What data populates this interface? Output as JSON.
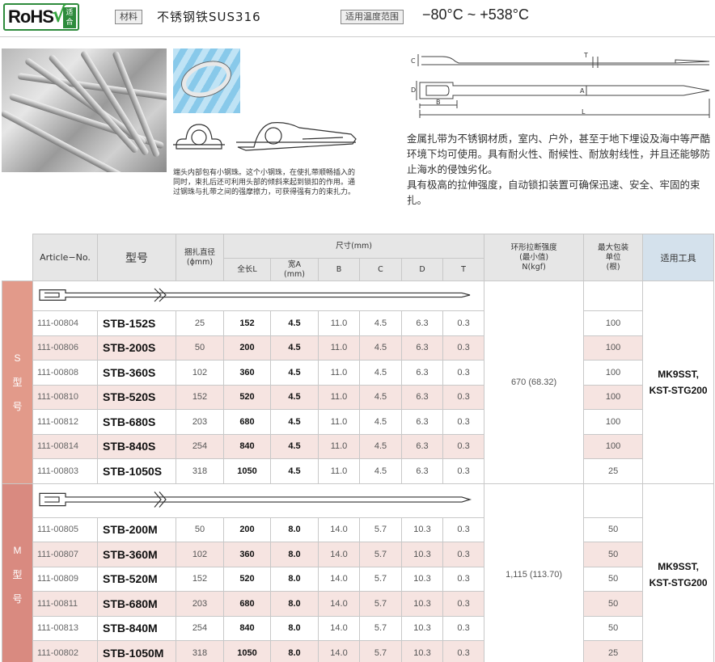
{
  "header": {
    "rohs_text": "RoHS",
    "rohs_check": "√",
    "rohs_badge": "适合",
    "material_tag": "材料",
    "material_value": "不锈钢铁SUS316",
    "temp_tag": "适用温度范围",
    "temp_value": "−80°C ~ +538°C"
  },
  "caption": "端头内部包有小钢珠。这个小钢珠，在使扎带顺畅插入的同时，束扎后还可利用头部的倾斜来起到锁扣的作用。通过钢珠与扎带之间的强摩擦力，可获得强有力的束扎力。",
  "description": [
    "金属扎带为不锈钢材质，室内、户外，甚至于地下埋设及海中等严酷环境下均可使用。具有耐火性、耐候性、耐放射线性，并且还能够防止海水的侵蚀劣化。",
    "具有极高的拉伸强度，自动锁扣装置可确保迅速、安全、牢固的束扎。"
  ],
  "dimension_labels": {
    "c": "C",
    "t": "T",
    "d": "D",
    "a": "A",
    "b": "B",
    "l": "L"
  },
  "table": {
    "headers": {
      "article": "Article−No.",
      "model": "型号",
      "bundle_dia": "捆扎直径",
      "bundle_unit": "(ϕmm)",
      "size": "尺寸(mm)",
      "len": "全长L",
      "width_a": "宽A",
      "width_unit": "(mm)",
      "b": "B",
      "c": "C",
      "d": "D",
      "t": "T",
      "strength_1": "环形拉断强度",
      "strength_2": "(最小值)",
      "strength_3": "N(kgf)",
      "pack_1": "最大包装",
      "pack_2": "单位",
      "pack_3": "(根)",
      "tools": "适用工具"
    },
    "groups": [
      {
        "side_label": [
          "S",
          "型",
          "号"
        ],
        "strength": "670 (68.32)",
        "tools": [
          "MK9SST,",
          "KST-STG200"
        ],
        "rows": [
          {
            "article": "111-00804",
            "model": "STB-152S",
            "dia": "25",
            "len": "152",
            "a": "4.5",
            "b": "11.0",
            "c": "4.5",
            "d": "6.3",
            "t": "0.3",
            "pack": "100"
          },
          {
            "article": "111-00806",
            "model": "STB-200S",
            "dia": "50",
            "len": "200",
            "a": "4.5",
            "b": "11.0",
            "c": "4.5",
            "d": "6.3",
            "t": "0.3",
            "pack": "100"
          },
          {
            "article": "111-00808",
            "model": "STB-360S",
            "dia": "102",
            "len": "360",
            "a": "4.5",
            "b": "11.0",
            "c": "4.5",
            "d": "6.3",
            "t": "0.3",
            "pack": "100"
          },
          {
            "article": "111-00810",
            "model": "STB-520S",
            "dia": "152",
            "len": "520",
            "a": "4.5",
            "b": "11.0",
            "c": "4.5",
            "d": "6.3",
            "t": "0.3",
            "pack": "100"
          },
          {
            "article": "111-00812",
            "model": "STB-680S",
            "dia": "203",
            "len": "680",
            "a": "4.5",
            "b": "11.0",
            "c": "4.5",
            "d": "6.3",
            "t": "0.3",
            "pack": "100"
          },
          {
            "article": "111-00814",
            "model": "STB-840S",
            "dia": "254",
            "len": "840",
            "a": "4.5",
            "b": "11.0",
            "c": "4.5",
            "d": "6.3",
            "t": "0.3",
            "pack": "100"
          },
          {
            "article": "111-00803",
            "model": "STB-1050S",
            "dia": "318",
            "len": "1050",
            "a": "4.5",
            "b": "11.0",
            "c": "4.5",
            "d": "6.3",
            "t": "0.3",
            "pack": "25"
          }
        ]
      },
      {
        "side_label": [
          "M",
          "型",
          "号"
        ],
        "strength": "1,115 (113.70)",
        "tools": [
          "MK9SST,",
          "KST-STG200"
        ],
        "rows": [
          {
            "article": "111-00805",
            "model": "STB-200M",
            "dia": "50",
            "len": "200",
            "a": "8.0",
            "b": "14.0",
            "c": "5.7",
            "d": "10.3",
            "t": "0.3",
            "pack": "50"
          },
          {
            "article": "111-00807",
            "model": "STB-360M",
            "dia": "102",
            "len": "360",
            "a": "8.0",
            "b": "14.0",
            "c": "5.7",
            "d": "10.3",
            "t": "0.3",
            "pack": "50"
          },
          {
            "article": "111-00809",
            "model": "STB-520M",
            "dia": "152",
            "len": "520",
            "a": "8.0",
            "b": "14.0",
            "c": "5.7",
            "d": "10.3",
            "t": "0.3",
            "pack": "50"
          },
          {
            "article": "111-00811",
            "model": "STB-680M",
            "dia": "203",
            "len": "680",
            "a": "8.0",
            "b": "14.0",
            "c": "5.7",
            "d": "10.3",
            "t": "0.3",
            "pack": "50"
          },
          {
            "article": "111-00813",
            "model": "STB-840M",
            "dia": "254",
            "len": "840",
            "a": "8.0",
            "b": "14.0",
            "c": "5.7",
            "d": "10.3",
            "t": "0.3",
            "pack": "50"
          },
          {
            "article": "111-00802",
            "model": "STB-1050M",
            "dia": "318",
            "len": "1050",
            "a": "8.0",
            "b": "14.0",
            "c": "5.7",
            "d": "10.3",
            "t": "0.3",
            "pack": "25"
          }
        ]
      }
    ]
  }
}
